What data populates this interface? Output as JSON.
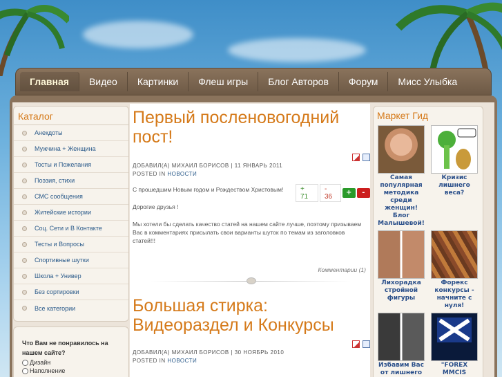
{
  "nav": {
    "items": [
      {
        "label": "Главная",
        "active": true
      },
      {
        "label": "Видео"
      },
      {
        "label": "Картинки"
      },
      {
        "label": "Флеш игры"
      },
      {
        "label": "Блог Авторов"
      },
      {
        "label": "Форум"
      },
      {
        "label": "Мисс Улыбка"
      }
    ]
  },
  "sidebar": {
    "title": "Каталог",
    "items": [
      "Анекдоты",
      "Мужчина + Женщина",
      "Тосты и Пожелания",
      "Поэзия, стихи",
      "СМС сообщения",
      "Житейские истории",
      "Соц. Сети и В Контакте",
      "Тесты и Вопросы",
      "Спортивные шутки",
      "Школа + Универ",
      "Без сортировки",
      "Все категории"
    ]
  },
  "poll": {
    "question": "Что Вам не понравилось на нашем сайте?",
    "options": [
      "Дизайн",
      "Наполнение"
    ]
  },
  "posts": [
    {
      "title": "Первый посленовогодний пост!",
      "meta_by": "ДОБАВИЛ(А) МИХАИЛ БОРИСОВ | 11 ЯНВАРЬ 2011",
      "posted_in": "POSTED IN",
      "category": "НОВОСТИ",
      "paragraphs": [
        "С прошедшим Новым годом и Рождеством Христовым!",
        "Дорогие друзья !",
        "Мы хотели бы сделать качество статей на нашем сайте лучше, поэтому призываем Вас в комментариях присылать свои варианты шуток по темам из заголовков статей!!!"
      ],
      "votes_up": "+ 71",
      "votes_down": "- 36",
      "comments": "Комментарии (1)"
    },
    {
      "title": "Большая стирка: Видеораздел и Конкурсы",
      "meta_by": "ДОБАВИЛ(А) МИХАИЛ БОРИСОВ | 30 НОЯБРЬ 2010",
      "posted_in": "POSTED IN",
      "category": "НОВОСТИ"
    }
  ],
  "vote_buttons": {
    "up": "+",
    "down": "-"
  },
  "market": {
    "title": "Маркет Гид",
    "ads": [
      {
        "caption": "Самая популярная методика среди женщин! Блог Малышевой!",
        "image": "woman-portrait"
      },
      {
        "caption": "Кризис лишнего веса?",
        "image": "broccoli-cartoon"
      },
      {
        "caption": "Лихорадка стройной фигуры",
        "image": "before-after-photo"
      },
      {
        "caption": "Форекс конкурсы - начните с нуля!",
        "image": "money-banknotes"
      },
      {
        "caption": "Избавим Вас от лишнего веса",
        "image": "weight-loss-photo"
      },
      {
        "caption": "\"FOREX MMCIS group\"",
        "image": "forex-logo"
      }
    ]
  },
  "colors": {
    "accent": "#d57a1a",
    "link": "#2a5a8a",
    "frame": "#8a735c"
  }
}
